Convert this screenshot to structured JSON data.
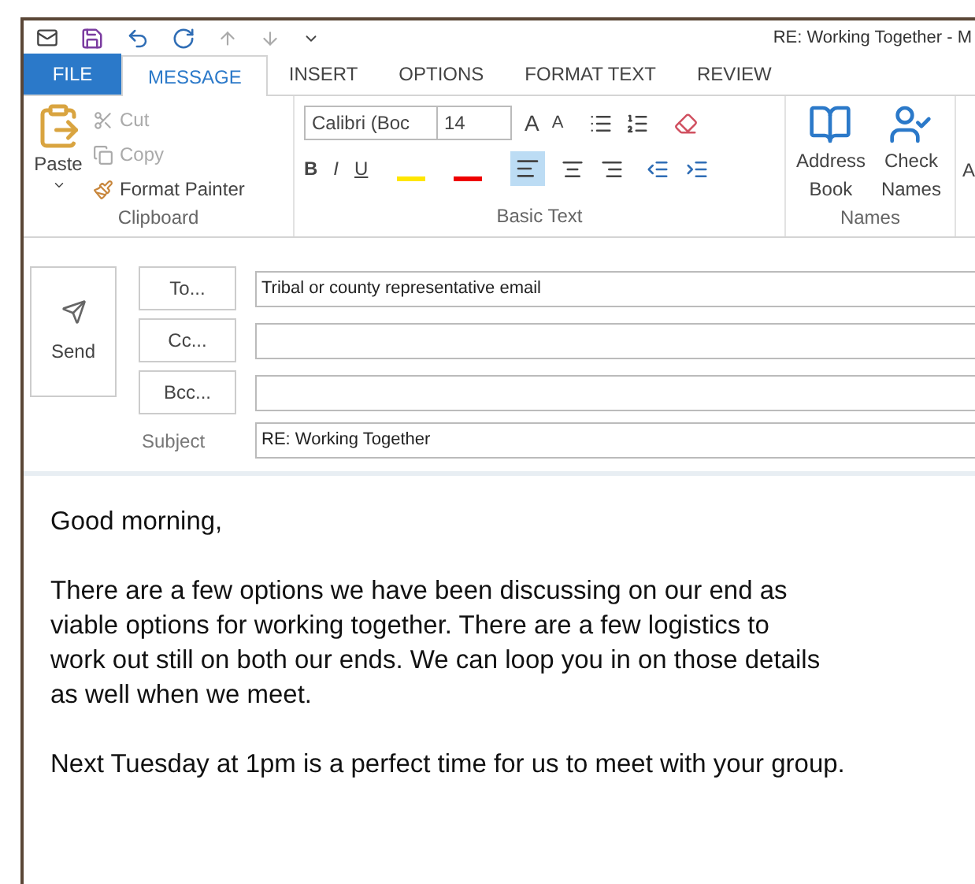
{
  "window": {
    "title": "RE: Working Together - M"
  },
  "tabs": [
    {
      "label": "FILE",
      "kind": "file",
      "selected": false
    },
    {
      "label": "MESSAGE",
      "kind": "tab",
      "selected": true
    },
    {
      "label": "INSERT",
      "kind": "tab",
      "selected": false
    },
    {
      "label": "OPTIONS",
      "kind": "tab",
      "selected": false
    },
    {
      "label": "FORMAT TEXT",
      "kind": "tab",
      "selected": false
    },
    {
      "label": "REVIEW",
      "kind": "tab",
      "selected": false
    }
  ],
  "ribbon": {
    "clipboard": {
      "paste": "Paste",
      "cut": "Cut",
      "copy": "Copy",
      "format_painter": "Format Painter",
      "label": "Clipboard"
    },
    "basic_text": {
      "font": "Calibri (Boc",
      "size": "14",
      "grow": "A",
      "shrink": "A",
      "bold": "B",
      "italic": "I",
      "underline": "U",
      "label": "Basic Text"
    },
    "names": {
      "address_book": "Address Book",
      "check_names": "Check Names",
      "label": "Names"
    },
    "cut_off_group": "A"
  },
  "compose": {
    "send": "Send",
    "fields": [
      {
        "label": "To...",
        "value": "Tribal or county representative email",
        "kind": "button"
      },
      {
        "label": "Cc...",
        "kind": "button"
      },
      {
        "label": "Bcc...",
        "kind": "button"
      },
      {
        "label": "Subject",
        "value": "RE: Working Together",
        "kind": "label"
      }
    ]
  },
  "body": [
    [
      "Good morning,"
    ],
    [
      "There are a few options we have been discussing on our end as",
      "viable options for working together. There are a few logistics to",
      "work out still on both our ends. We can loop you in on those details",
      "as well when we meet."
    ],
    [
      "Next Tuesday at 1pm is a perfect time for us to meet with your group."
    ]
  ]
}
